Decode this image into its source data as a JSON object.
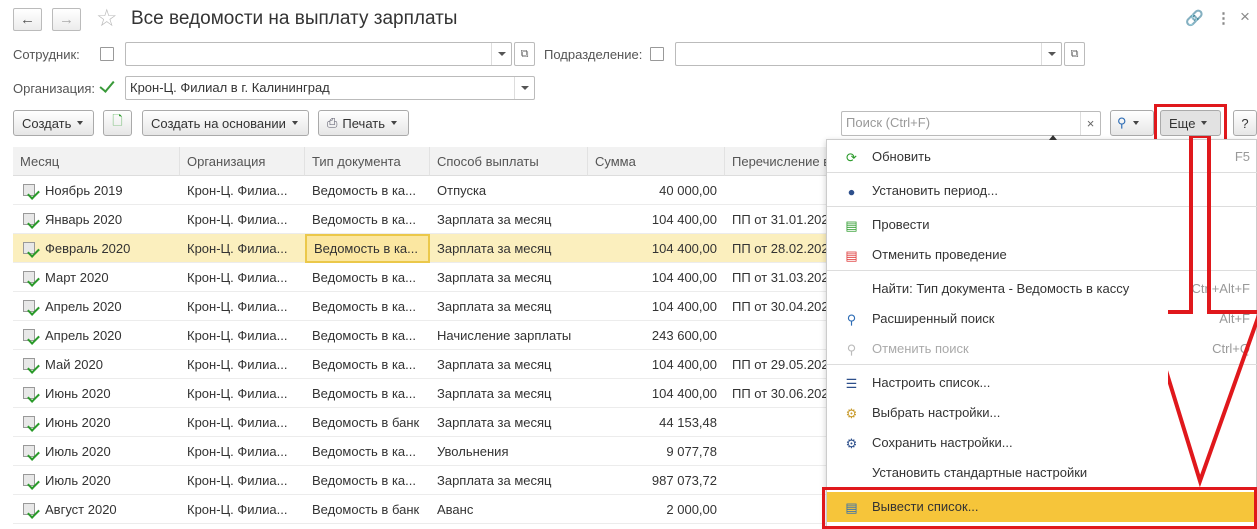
{
  "window": {
    "title": "Все ведомости на выплату зарплаты"
  },
  "filters": {
    "employee_label": "Сотрудник:",
    "employee_value": "",
    "department_label": "Подразделение:",
    "department_value": "",
    "org_label": "Организация:",
    "org_value": "Крон-Ц. Филиал в г. Калининград"
  },
  "toolbar": {
    "create": "Создать",
    "create_based": "Создать на основании",
    "print": "Печать",
    "search_placeholder": "Поиск (Ctrl+F)",
    "more": "Еще",
    "help": "?"
  },
  "table": {
    "columns": [
      "Месяц",
      "Организация",
      "Тип документа",
      "Способ выплаты",
      "Сумма",
      "Перечисление в"
    ],
    "rows": [
      {
        "month": "Ноябрь 2019",
        "org": "Крон-Ц. Филиа...",
        "type": "Ведомость в ка...",
        "method": "Отпуска",
        "sum": "40 000,00",
        "transfer": ""
      },
      {
        "month": "Январь 2020",
        "org": "Крон-Ц. Филиа...",
        "type": "Ведомость в ка...",
        "method": "Зарплата за месяц",
        "sum": "104 400,00",
        "transfer": "ПП от 31.01.202"
      },
      {
        "month": "Февраль 2020",
        "org": "Крон-Ц. Филиа...",
        "type": "Ведомость в ка...",
        "method": "Зарплата за месяц",
        "sum": "104 400,00",
        "transfer": "ПП от 28.02.202"
      },
      {
        "month": "Март 2020",
        "org": "Крон-Ц. Филиа...",
        "type": "Ведомость в ка...",
        "method": "Зарплата за месяц",
        "sum": "104 400,00",
        "transfer": "ПП от 31.03.202"
      },
      {
        "month": "Апрель 2020",
        "org": "Крон-Ц. Филиа...",
        "type": "Ведомость в ка...",
        "method": "Зарплата за месяц",
        "sum": "104 400,00",
        "transfer": "ПП от 30.04.202"
      },
      {
        "month": "Апрель 2020",
        "org": "Крон-Ц. Филиа...",
        "type": "Ведомость в ка...",
        "method": "Начисление зарплаты",
        "sum": "243 600,00",
        "transfer": ""
      },
      {
        "month": "Май 2020",
        "org": "Крон-Ц. Филиа...",
        "type": "Ведомость в ка...",
        "method": "Зарплата за месяц",
        "sum": "104 400,00",
        "transfer": "ПП от 29.05.202"
      },
      {
        "month": "Июнь 2020",
        "org": "Крон-Ц. Филиа...",
        "type": "Ведомость в ка...",
        "method": "Зарплата за месяц",
        "sum": "104 400,00",
        "transfer": "ПП от 30.06.202"
      },
      {
        "month": "Июнь 2020",
        "org": "Крон-Ц. Филиа...",
        "type": "Ведомость в банк",
        "method": "Зарплата за месяц",
        "sum": "44 153,48",
        "transfer": ""
      },
      {
        "month": "Июль 2020",
        "org": "Крон-Ц. Филиа...",
        "type": "Ведомость в ка...",
        "method": "Увольнения",
        "sum": "9 077,78",
        "transfer": ""
      },
      {
        "month": "Июль 2020",
        "org": "Крон-Ц. Филиа...",
        "type": "Ведомость в ка...",
        "method": "Зарплата за месяц",
        "sum": "987 073,72",
        "transfer": ""
      },
      {
        "month": "Август 2020",
        "org": "Крон-Ц. Филиа...",
        "type": "Ведомость в банк",
        "method": "Аванс",
        "sum": "2 000,00",
        "transfer": ""
      }
    ]
  },
  "menu": {
    "items": [
      {
        "label": "Обновить",
        "shortcut": "F5"
      },
      {
        "label": "Установить период...",
        "shortcut": ""
      },
      {
        "label": "Провести",
        "shortcut": ""
      },
      {
        "label": "Отменить проведение",
        "shortcut": ""
      },
      {
        "label": "Найти: Тип документа - Ведомость в кассу",
        "shortcut": "Ctrl+Alt+F"
      },
      {
        "label": "Расширенный поиск",
        "shortcut": "Alt+F"
      },
      {
        "label": "Отменить поиск",
        "shortcut": "Ctrl+Q"
      },
      {
        "label": "Настроить список...",
        "shortcut": ""
      },
      {
        "label": "Выбрать настройки...",
        "shortcut": ""
      },
      {
        "label": "Сохранить настройки...",
        "shortcut": ""
      },
      {
        "label": "Установить стандартные настройки",
        "shortcut": ""
      },
      {
        "label": "Вывести список...",
        "shortcut": ""
      }
    ]
  },
  "colors": {
    "accent": "#e0181c",
    "highlight": "#f6c53a",
    "selected_row": "#fbefbe"
  }
}
